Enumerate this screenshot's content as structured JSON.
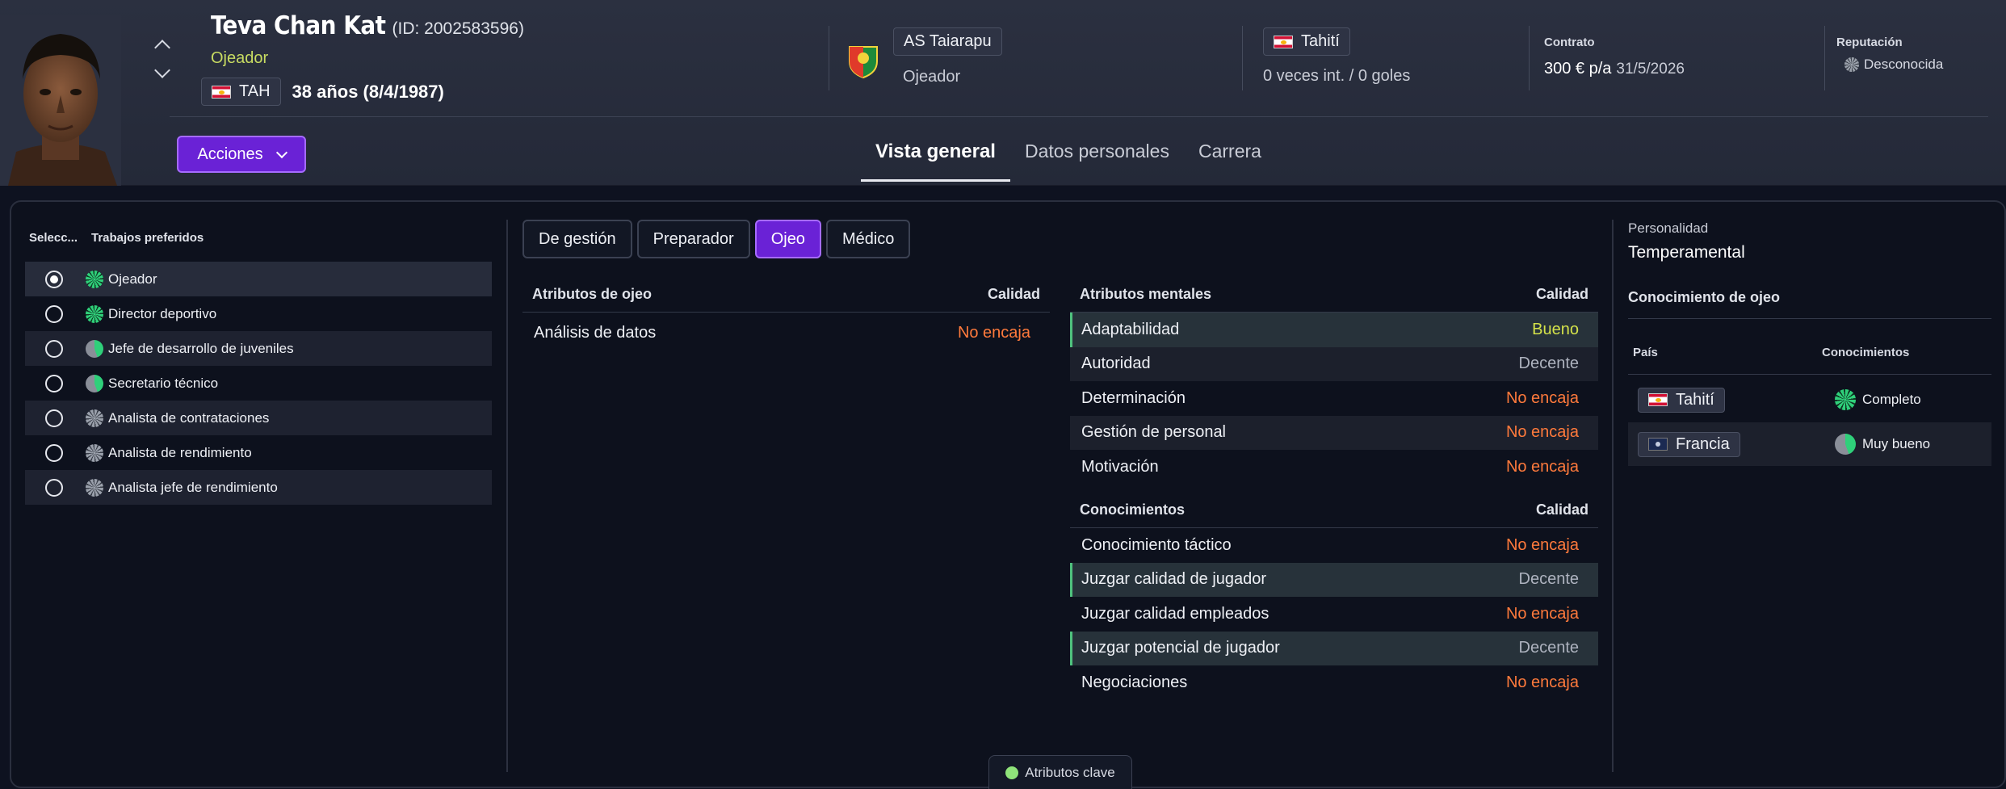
{
  "header": {
    "name": "Teva Chan Kat",
    "id_text": "(ID: 2002583596)",
    "role": "Ojeador",
    "nation_code": "TAH",
    "age_text": "38 años (8/4/1987)",
    "club_name": "AS Taiarapu",
    "club_role": "Ojeador",
    "nation_name": "Tahití",
    "caps_text": "0 veces int. / 0 goles",
    "contract_label": "Contrato",
    "contract_wage": "300 € p/a",
    "contract_date": "31/5/2026",
    "reputation_label": "Reputación",
    "reputation_value": "Desconocida",
    "actions_label": "Acciones",
    "tabs": [
      "Vista general",
      "Datos personales",
      "Carrera"
    ]
  },
  "jobs": {
    "col_select": "Selecc...",
    "col_jobs": "Trabajos preferidos",
    "items": [
      {
        "label": "Ojeador"
      },
      {
        "label": "Director deportivo"
      },
      {
        "label": "Jefe de desarrollo de juveniles"
      },
      {
        "label": "Secretario técnico"
      },
      {
        "label": "Analista de contrataciones"
      },
      {
        "label": "Analista de rendimiento"
      },
      {
        "label": "Analista jefe de rendimiento"
      }
    ]
  },
  "subtabs": [
    "De gestión",
    "Preparador",
    "Ojeo",
    "Médico"
  ],
  "scout_attrs": {
    "title": "Atributos de ojeo",
    "quality_label": "Calidad",
    "rows": [
      {
        "name": "Análisis de datos",
        "quality": "No encaja"
      }
    ]
  },
  "mental_attrs": {
    "title": "Atributos mentales",
    "quality_label": "Calidad",
    "rows": [
      {
        "name": "Adaptabilidad",
        "quality": "Bueno"
      },
      {
        "name": "Autoridad",
        "quality": "Decente"
      },
      {
        "name": "Determinación",
        "quality": "No encaja"
      },
      {
        "name": "Gestión de personal",
        "quality": "No encaja"
      },
      {
        "name": "Motivación",
        "quality": "No encaja"
      }
    ]
  },
  "knowledge_attrs": {
    "title": "Conocimientos",
    "quality_label": "Calidad",
    "rows": [
      {
        "name": "Conocimiento táctico",
        "quality": "No encaja"
      },
      {
        "name": "Juzgar calidad de jugador",
        "quality": "Decente"
      },
      {
        "name": "Juzgar calidad empleados",
        "quality": "No encaja"
      },
      {
        "name": "Juzgar potencial de jugador",
        "quality": "Decente"
      },
      {
        "name": "Negociaciones",
        "quality": "No encaja"
      }
    ]
  },
  "personality": {
    "label": "Personalidad",
    "value": "Temperamental"
  },
  "scout_knowledge": {
    "title": "Conocimiento de ojeo",
    "col_country": "País",
    "col_knowledge": "Conocimientos",
    "rows": [
      {
        "country": "Tahití",
        "level": "Completo"
      },
      {
        "country": "Francia",
        "level": "Muy bueno"
      }
    ]
  },
  "footer": {
    "key_attrs_label": "Atributos clave"
  },
  "colors": {
    "accent": "#6a22d6",
    "quality_bad": "#ff7a3c",
    "quality_ok": "#aeb3bf",
    "quality_good": "#d4e24a",
    "highlight_bar": "#4fc27e"
  }
}
